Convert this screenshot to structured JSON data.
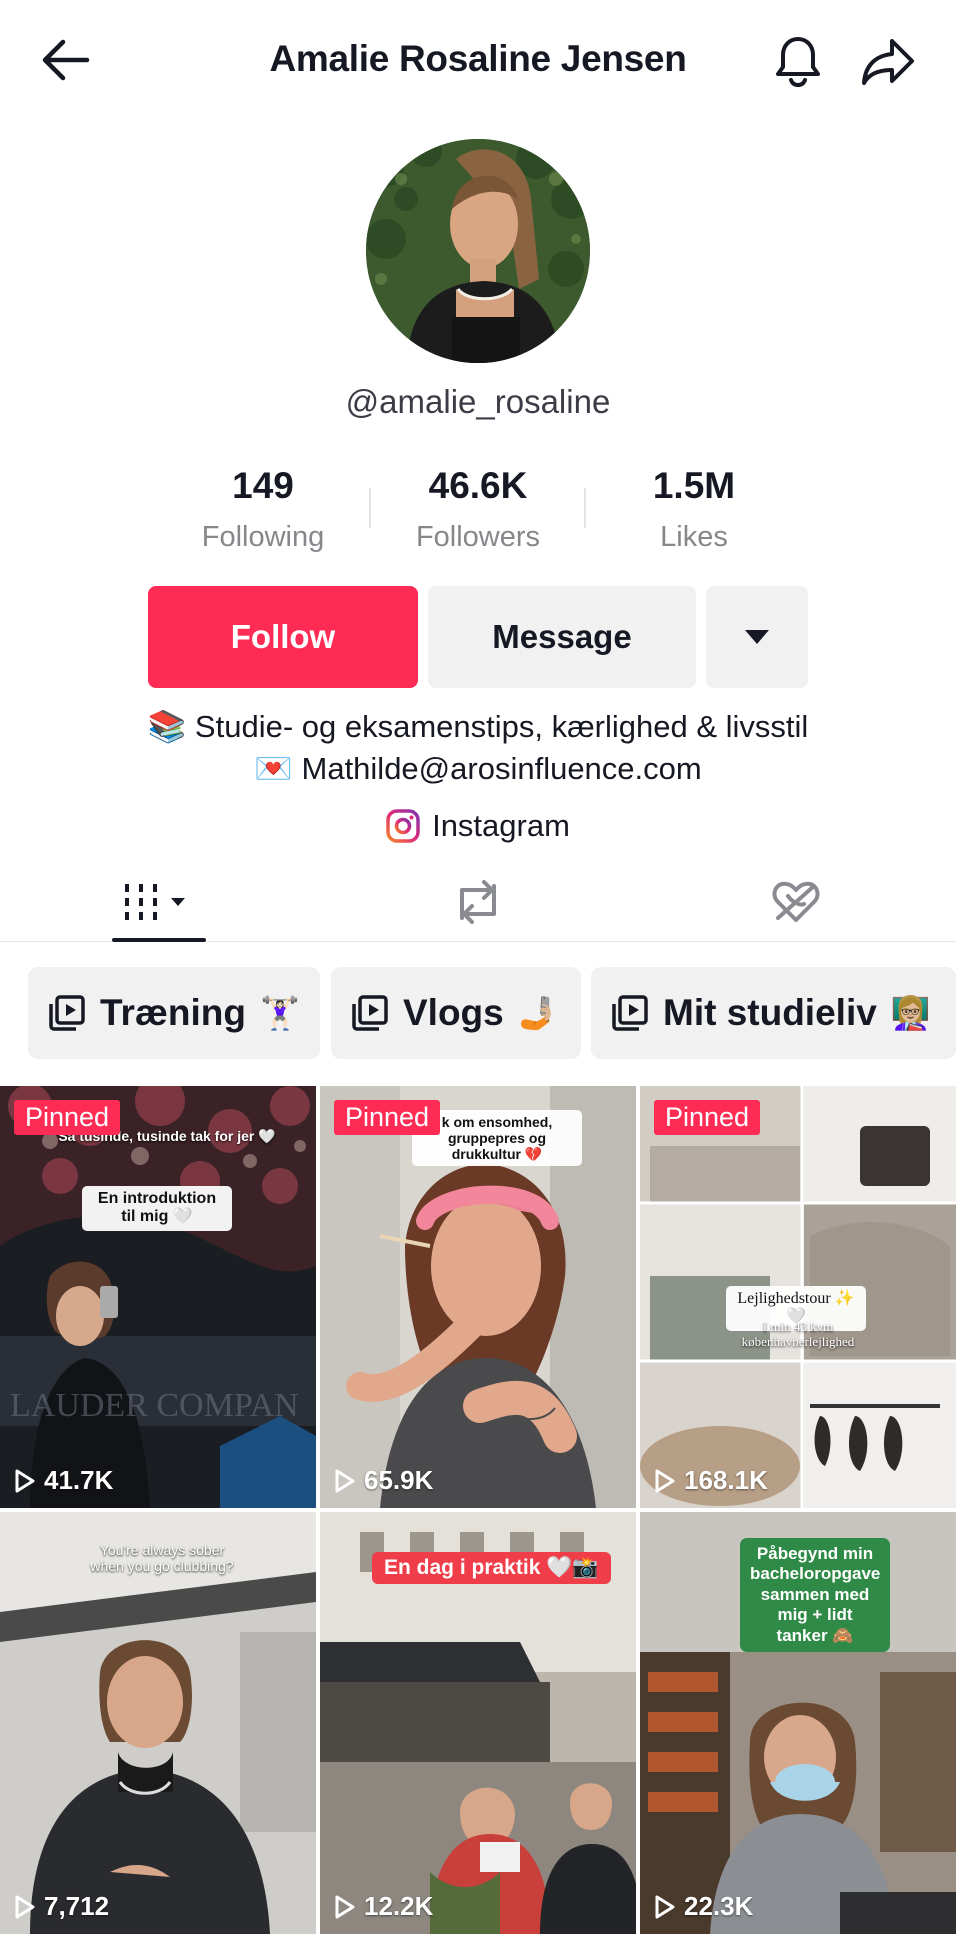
{
  "header": {
    "title": "Amalie Rosaline Jensen",
    "back_icon": "arrow-left-icon",
    "bell_icon": "bell-icon",
    "share_icon": "share-arrow-icon"
  },
  "profile": {
    "handle": "@amalie_rosaline",
    "stats": [
      {
        "value": "149",
        "label": "Following"
      },
      {
        "value": "46.6K",
        "label": "Followers"
      },
      {
        "value": "1.5M",
        "label": "Likes"
      }
    ]
  },
  "actions": {
    "follow_label": "Follow",
    "message_label": "Message",
    "more_icon": "caret-down-icon"
  },
  "bio": {
    "line1_emoji": "📚",
    "line1_text": "Studie- og eksamenstips, kærlighed & livsstil",
    "line2_emoji": "💌",
    "line2_text": "Mathilde@arosinfluence.com",
    "instagram_label": "Instagram"
  },
  "tabs": [
    {
      "icon": "videos-grid-icon",
      "active": true
    },
    {
      "icon": "repost-icon",
      "active": false
    },
    {
      "icon": "liked-hidden-icon",
      "active": false
    }
  ],
  "playlists": [
    {
      "label": "Træning",
      "emoji": "🏋🏻‍♀️"
    },
    {
      "label": "Vlogs",
      "emoji": "🤳🏼"
    },
    {
      "label": "Mit studieliv",
      "emoji": "👩🏼‍🏫"
    }
  ],
  "videos": [
    {
      "pinned": "Pinned",
      "views": "41.7K",
      "caption1": "Så tusinde, tusinde tak for jer 🤍",
      "caption2": "En introduktion til mig 🤍"
    },
    {
      "pinned": "Pinned",
      "views": "65.9K",
      "caption1": "k om ensomhed, gruppepres og drukkultur 💔"
    },
    {
      "pinned": "Pinned",
      "views": "168.1K",
      "caption1": "Lejlighedstour ✨🤍",
      "caption2": "I min 43 kvm københavnerlejlighed"
    },
    {
      "views": "7,712",
      "caption1": "You're always sober when you go clubbing?"
    },
    {
      "views": "12.2K",
      "caption1": "En dag i praktik 🤍📸"
    },
    {
      "views": "22.3K",
      "caption1": "Påbegynd min bacheloropgave sammen med mig + lidt tanker 🙈"
    }
  ]
}
